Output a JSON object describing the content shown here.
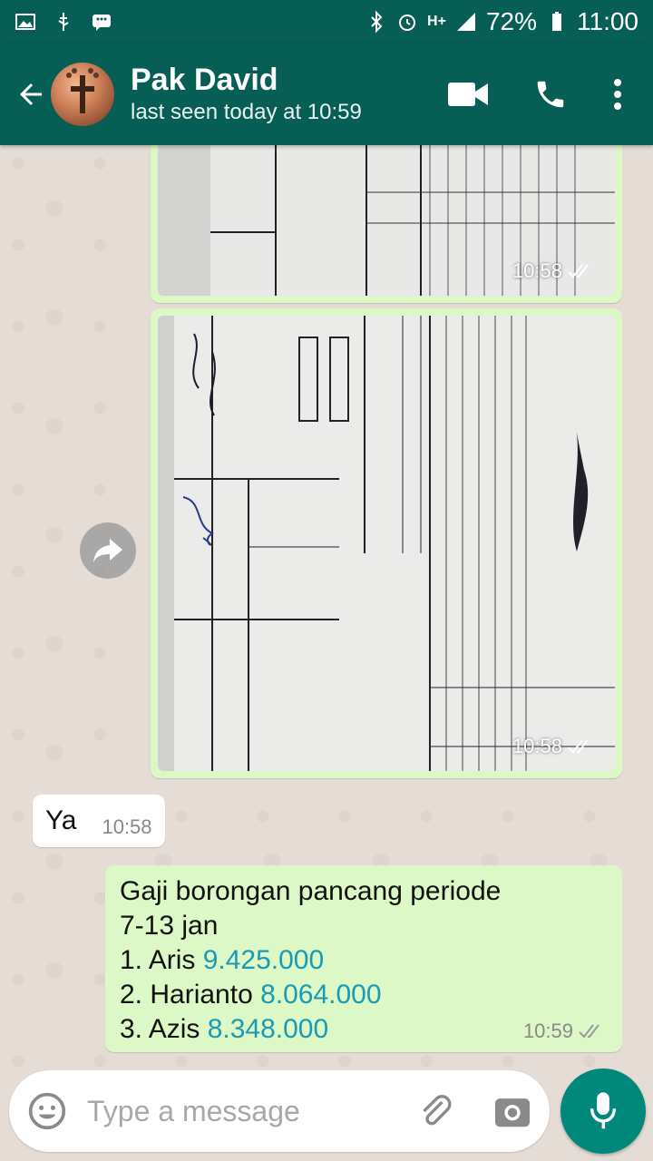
{
  "statusbar": {
    "battery": "72%",
    "time": "11:00",
    "network": "H+"
  },
  "header": {
    "contact_name": "Pak David",
    "status": "last seen today at 10:59"
  },
  "messages": {
    "image1_time": "10:58",
    "image2_time": "10:58",
    "incoming": {
      "text": "Ya",
      "time": "10:58"
    },
    "outgoing": {
      "line1": "Gaji borongan pancang periode",
      "line2": "7-13 jan",
      "item1_label": "1. Aris ",
      "item1_value": "9.425.000",
      "item2_label": "2. Harianto ",
      "item2_value": "8.064.000",
      "item3_label": "3. Azis ",
      "item3_value": "8.348.000",
      "time": "10:59"
    }
  },
  "input": {
    "placeholder": "Type a message"
  },
  "colors": {
    "header": "#075e54",
    "outgoing_bubble": "#dcf8c6",
    "incoming_bubble": "#ffffff",
    "mic": "#00897b",
    "number_link": "#1a9bb3"
  }
}
